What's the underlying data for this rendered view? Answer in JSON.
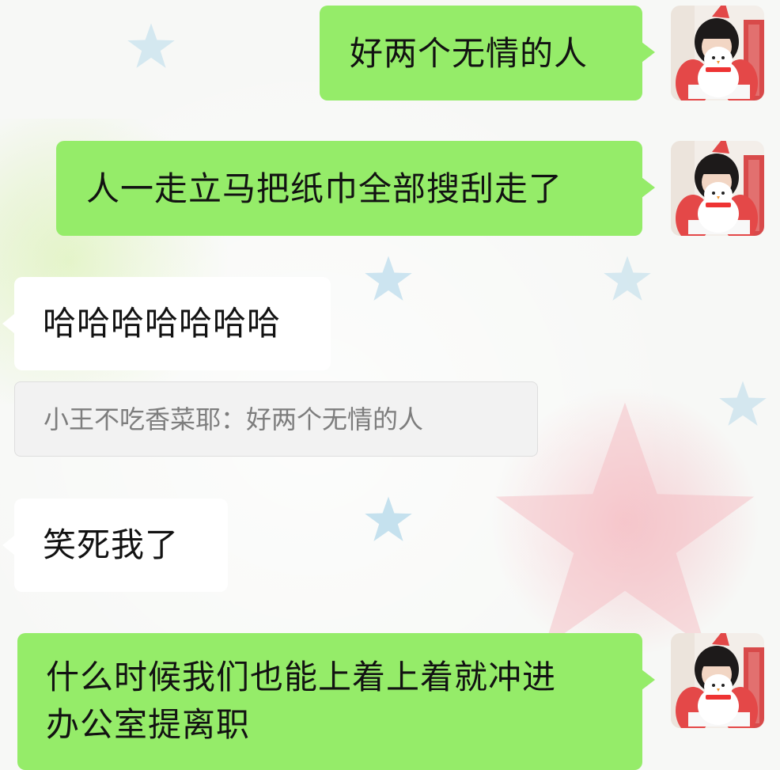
{
  "chat": {
    "messages": [
      {
        "sender": "me",
        "text": "好两个无情的人"
      },
      {
        "sender": "me",
        "text": "人一走立马把纸巾全部搜刮走了"
      },
      {
        "sender": "other",
        "text": "哈哈哈哈哈哈哈"
      },
      {
        "sender": "quote",
        "author": "小王不吃香菜耶",
        "separator": "：",
        "text": "好两个无情的人"
      },
      {
        "sender": "other",
        "text": "笑死我了"
      },
      {
        "sender": "me",
        "line1": "什么时候我们也能上着上着就冲进",
        "line2": "办公室提离职"
      }
    ]
  },
  "colors": {
    "my_bubble": "#95ec69",
    "other_bubble": "#ffffff",
    "quote_bg": "#f2f2f2",
    "quote_text": "#7d7d7d"
  },
  "icons": [
    "user-avatar-icon",
    "background-star-icon"
  ]
}
